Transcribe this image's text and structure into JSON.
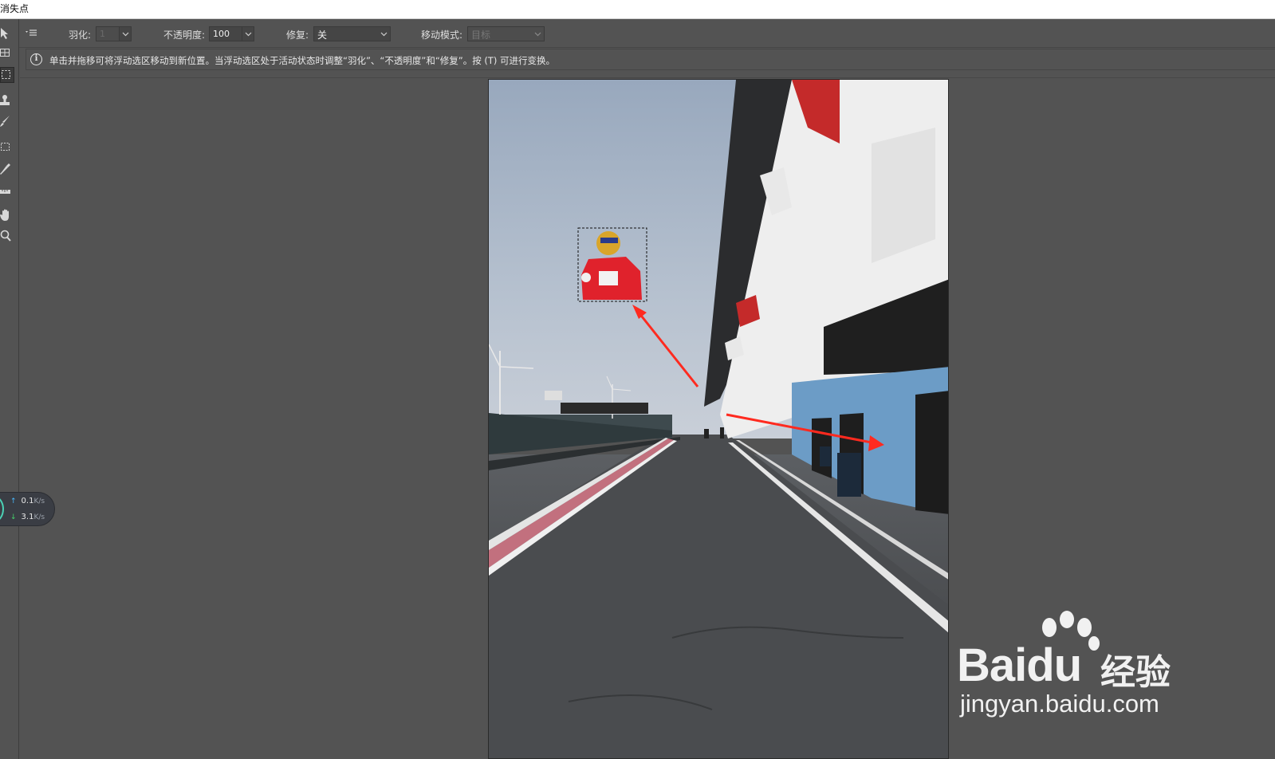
{
  "window": {
    "title": "消失点"
  },
  "toolbar": {
    "tools": [
      {
        "name": "edit-planes-tool"
      },
      {
        "name": "create-plane-tool"
      },
      {
        "name": "marquee-tool",
        "active": true
      },
      {
        "name": "stamp-tool"
      },
      {
        "name": "brush-tool"
      },
      {
        "name": "transform-tool"
      },
      {
        "name": "eyedropper-tool"
      },
      {
        "name": "measure-tool"
      },
      {
        "name": "hand-tool"
      },
      {
        "name": "zoom-tool"
      }
    ]
  },
  "options": {
    "menu_icon": "≡",
    "feather_label": "羽化:",
    "feather_value": "1",
    "opacity_label": "不透明度:",
    "opacity_value": "100",
    "heal_label": "修复:",
    "heal_value": "关",
    "move_mode_label": "移动模式:",
    "move_mode_value": "目标"
  },
  "info": {
    "icon": "i",
    "text": "单击并拖移可将浮动选区移动到新位置。当浮动选区处于活动状态时调整“羽化”、“不透明度”和“修复”。按 (T) 可进行变换。"
  },
  "netspeed": {
    "up_value": "0.1",
    "up_unit": "K/s",
    "down_value": "3.1",
    "down_unit": "K/s",
    "up_arrow": "↑",
    "down_arrow": "↓"
  },
  "watermark": {
    "brand_left": "Bai",
    "brand_right": "du",
    "brand_cn": "经验",
    "url": "jingyan.baidu.com"
  },
  "colors": {
    "panel": "#535353",
    "annotation_arrow": "#ff2a1f",
    "pit_wall_blue": "#6c9cc6"
  }
}
